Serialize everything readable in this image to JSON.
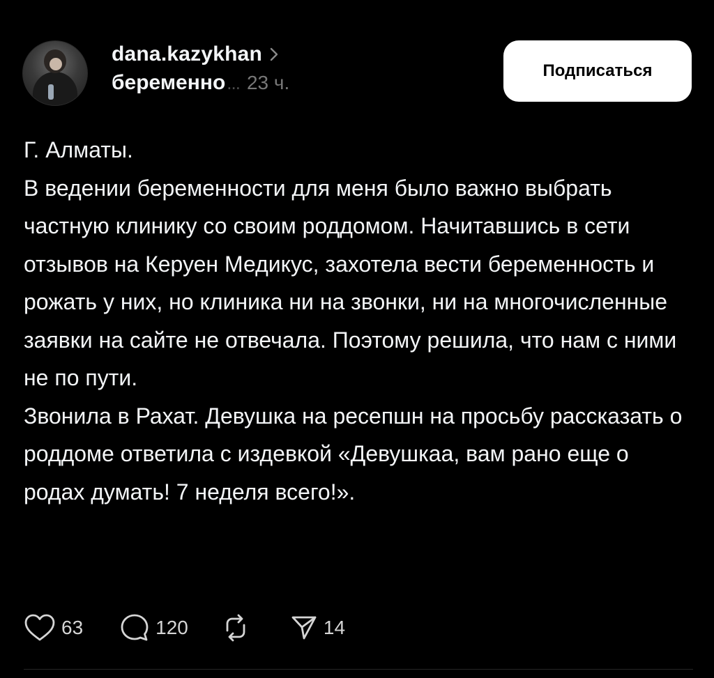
{
  "post": {
    "author": {
      "username": "dana.kazykhan",
      "avatar_alt": "avatar"
    },
    "topic": "беременно",
    "topic_ellipsis": "...",
    "time": "23 ч.",
    "follow_label": "Подписаться",
    "paragraphs": [
      "Г. Алматы.",
      "В ведении беременности для меня было важно выбрать частную клинику со своим роддомом. Начитавшись в сети отзывов на Керуен Медикус, захотела вести беременность и рожать у них, но клиника ни на звонки, ни на многочисленные заявки на сайте не отвечала. Поэтому решила, что нам с ними не по пути.",
      "Звонила в Рахат. Девушка на ресепшн на просьбу рассказать о роддоме ответила с издевкой «Девушкаа, вам рано еще о родах думать! 7 неделя всего!»."
    ],
    "actions": {
      "likes": "63",
      "replies": "120",
      "shares": "14"
    }
  },
  "colors": {
    "background": "#000000",
    "text_primary": "#f3f5f7",
    "text_secondary": "#777777",
    "button_bg": "#ffffff",
    "button_text": "#000000"
  },
  "icons": [
    "chevron-right-icon",
    "heart-icon",
    "comment-icon",
    "repost-icon",
    "share-icon"
  ]
}
